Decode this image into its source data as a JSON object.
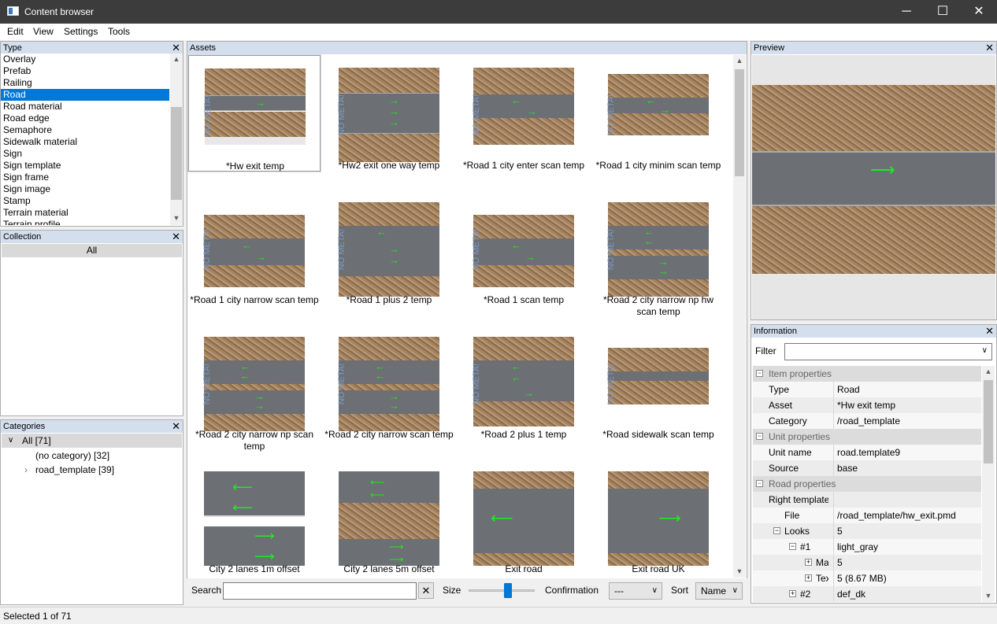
{
  "window": {
    "title": "Content browser",
    "minimize": "─",
    "maximize": "☐",
    "close": "✕"
  },
  "menu": [
    "Edit",
    "View",
    "Settings",
    "Tools"
  ],
  "type_panel": {
    "title": "Type",
    "items": [
      "Overlay",
      "Prefab",
      "Railing",
      "Road",
      "Road material",
      "Road edge",
      "Semaphore",
      "Sidewalk material",
      "Sign",
      "Sign template",
      "Sign frame",
      "Sign image",
      "Stamp",
      "Terrain material",
      "Terrain profile"
    ],
    "selected": "Road"
  },
  "collection_panel": {
    "title": "Collection",
    "item": "All"
  },
  "categories_panel": {
    "title": "Categories",
    "root": "All [71]",
    "children": [
      "(no category) [32]",
      "road_template [39]"
    ]
  },
  "assets_panel": {
    "title": "Assets",
    "items": [
      "*Hw exit temp",
      "*Hw2 exit one way temp",
      "*Road 1 city enter scan temp",
      "*Road 1 city minim scan temp",
      "*Road 1 city narrow scan temp",
      "*Road 1 plus 2 temp",
      "*Road 1 scan temp",
      "*Road 2 city narrow np hw scan temp",
      "*Road 2 city narrow np scan temp",
      "*Road 2 city narrow scan temp",
      "*Road 2 plus 1 temp",
      "*Road sidewalk scan temp",
      "City 2 lanes 1m offset",
      "City 2 lanes 5m offset",
      "Exit road",
      "Exit road UK"
    ],
    "no_meta_label": "NO META!"
  },
  "toolbar": {
    "search_label": "Search",
    "search_value": "",
    "size_label": "Size",
    "size_value": 0.6,
    "confirmation_label": "Confirmation",
    "confirmation_value": "---",
    "sort_label": "Sort",
    "sort_value": "Name"
  },
  "preview_panel": {
    "title": "Preview"
  },
  "info_panel": {
    "title": "Information",
    "filter_label": "Filter",
    "filter_value": "",
    "rows": [
      {
        "kind": "section",
        "label": "Item properties"
      },
      {
        "kind": "prop",
        "label": "Type",
        "value": "Road",
        "indent": 0
      },
      {
        "kind": "prop",
        "label": "Asset",
        "value": "*Hw exit temp",
        "indent": 0
      },
      {
        "kind": "prop",
        "label": "Category",
        "value": "/road_template",
        "indent": 0
      },
      {
        "kind": "section",
        "label": "Unit properties"
      },
      {
        "kind": "prop",
        "label": "Unit name",
        "value": "road.template9",
        "indent": 0
      },
      {
        "kind": "prop",
        "label": "Source",
        "value": "base",
        "indent": 0
      },
      {
        "kind": "section",
        "label": "Road properties"
      },
      {
        "kind": "prop",
        "label": "Right template",
        "value": "",
        "indent": 0
      },
      {
        "kind": "prop",
        "label": "File",
        "value": "/road_template/hw_exit.pmd",
        "indent": 1
      },
      {
        "kind": "prop",
        "label": "Looks",
        "value": "5",
        "indent": 1,
        "toggle": "−"
      },
      {
        "kind": "prop",
        "label": "#1",
        "value": "light_gray",
        "indent": 2,
        "toggle": "−"
      },
      {
        "kind": "prop",
        "label": "Mat",
        "value": "5",
        "indent": 3,
        "toggle": "+"
      },
      {
        "kind": "prop",
        "label": "Tex",
        "value": "5 (8.67 MB)",
        "indent": 3,
        "toggle": "+"
      },
      {
        "kind": "prop",
        "label": "#2",
        "value": "def_dk",
        "indent": 2,
        "toggle": "+"
      }
    ]
  },
  "status": {
    "text": "Selected 1 of 71"
  }
}
